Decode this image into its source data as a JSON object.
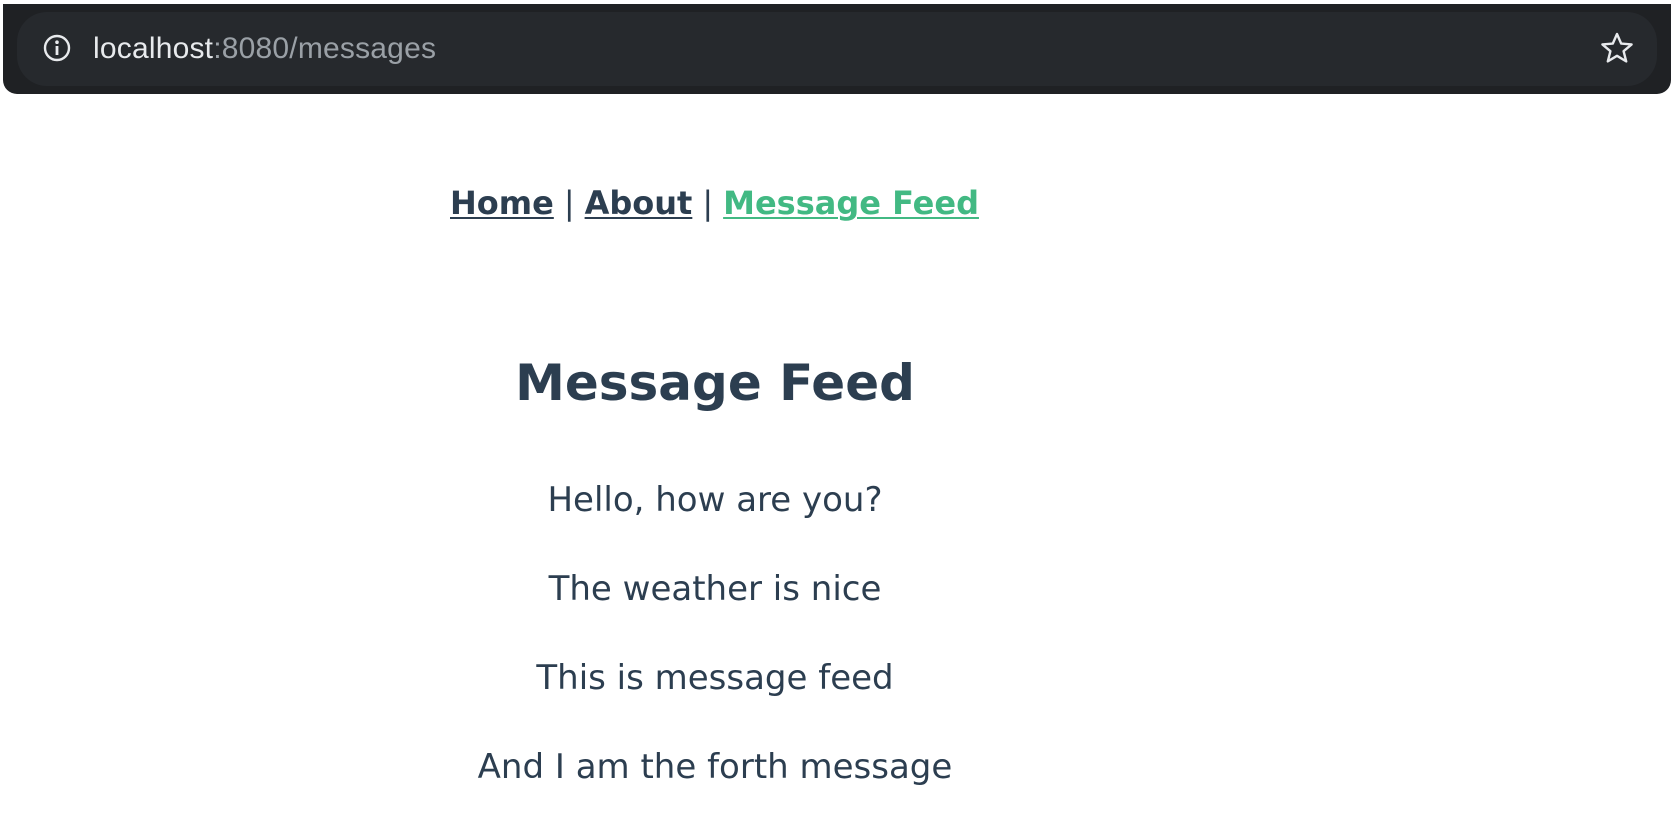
{
  "browser": {
    "url_host": "localhost",
    "url_path": ":8080/messages",
    "info_icon": "info-icon",
    "bookmark_icon": "star-icon"
  },
  "nav": {
    "items": [
      {
        "label": "Home",
        "active": false
      },
      {
        "label": "About",
        "active": false
      },
      {
        "label": "Message Feed",
        "active": true
      }
    ],
    "separator": "|",
    "active_color": "#42b983",
    "text_color": "#2c3e50"
  },
  "page": {
    "title": "Message Feed",
    "messages": [
      "Hello, how are you?",
      "The weather is nice",
      "This is message feed",
      "And I am the forth message"
    ]
  }
}
